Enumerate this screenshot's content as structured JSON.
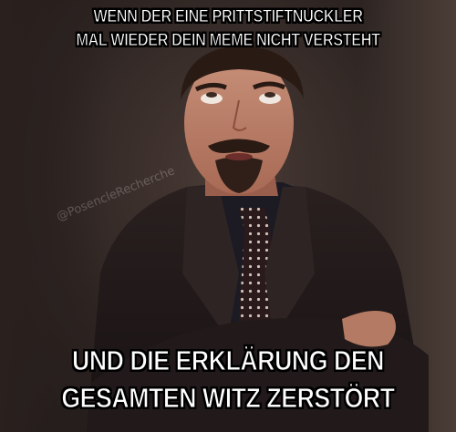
{
  "meme": {
    "top_text": [
      "WENN DER EINE PRITTSTIFTNUCKLER",
      "MAL WIEDER DEIN MEME NICHT VERSTEHT"
    ],
    "bottom_text": [
      "UND DIE ERKLÄRUNG DEN",
      "GESAMTEN WITZ ZERSTÖRT"
    ],
    "watermark": "@PosencleRecherche",
    "text_color": "#ffffff",
    "outline_color": "#000000"
  }
}
